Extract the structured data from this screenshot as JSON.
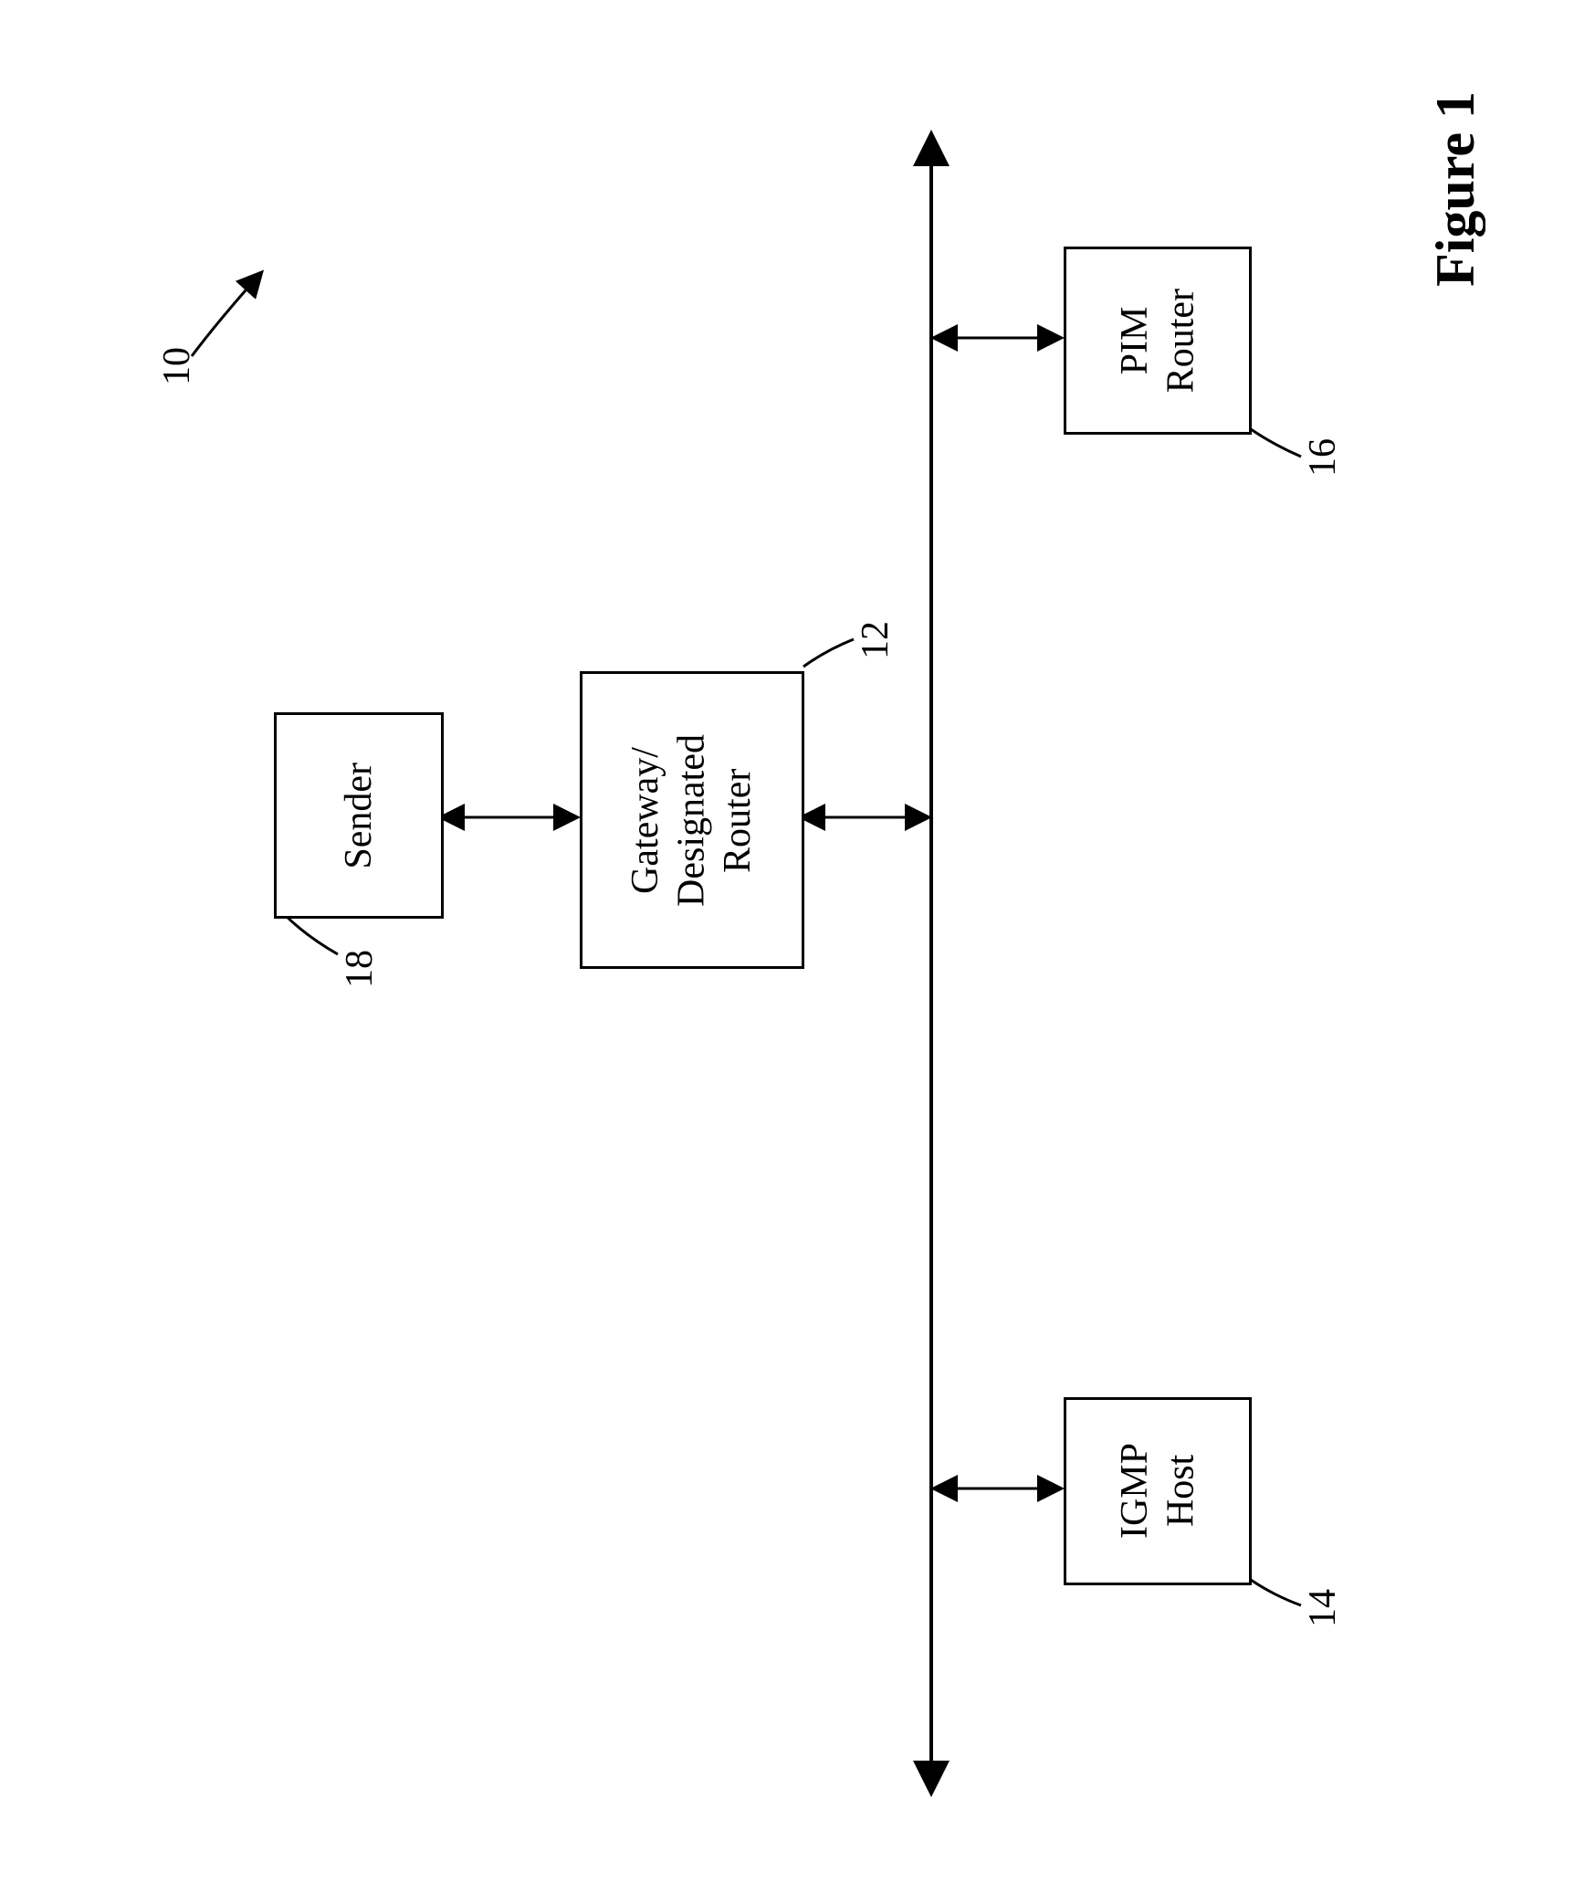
{
  "figure_label": "Figure 1",
  "system_ref": "10",
  "boxes": {
    "sender": {
      "label": "Sender",
      "ref": "18"
    },
    "gateway": {
      "label_line1": "Gateway/",
      "label_line2": "Designated",
      "label_line3": "Router",
      "ref": "12"
    },
    "igmp": {
      "label_line1": "IGMP",
      "label_line2": "Host",
      "ref": "14"
    },
    "pim": {
      "label_line1": "PIM",
      "label_line2": "Router",
      "ref": "16"
    }
  }
}
